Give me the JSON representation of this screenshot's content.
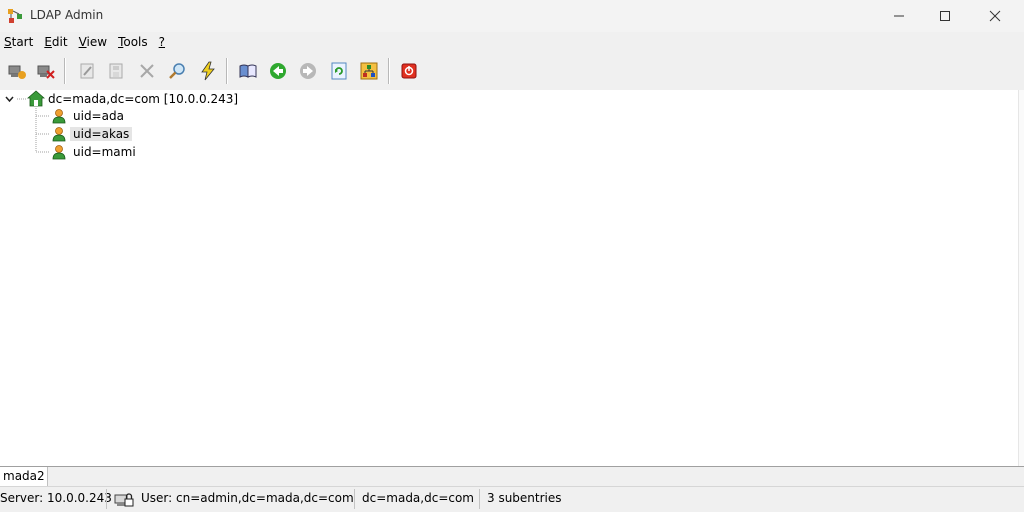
{
  "window": {
    "title": "LDAP Admin",
    "minimize_glyph": "—",
    "maximize_glyph": "☐",
    "close_glyph": "✕"
  },
  "menu": {
    "start": {
      "key": "S",
      "rest": "tart"
    },
    "edit": {
      "key": "E",
      "rest": "dit"
    },
    "view": {
      "key": "V",
      "rest": "iew"
    },
    "tools": {
      "key": "T",
      "rest": "ools"
    },
    "help": {
      "key": "?",
      "rest": ""
    }
  },
  "toolbar_icons": [
    "connect-icon",
    "disconnect-icon",
    "edit-entry-icon",
    "save-entry-icon",
    "delete-icon",
    "search-icon",
    "quick-action-icon",
    "schema-book-icon",
    "back-icon",
    "forward-icon",
    "refresh-icon",
    "tree-icon",
    "exit-icon"
  ],
  "tree": {
    "root": "dc=mada,dc=com [10.0.0.243]",
    "children": [
      "uid=ada",
      "uid=akas",
      "uid=mami"
    ]
  },
  "tabs": {
    "active": "mada2"
  },
  "status": {
    "server": "Server: 10.0.0.243",
    "user": "User: cn=admin,dc=mada,dc=com",
    "base": "dc=mada,dc=com",
    "count": "3 subentries"
  },
  "colors": {
    "selection": "#e5e5e5",
    "chrome": "#f0f0f0",
    "titlebar": "#f3f3f3"
  }
}
